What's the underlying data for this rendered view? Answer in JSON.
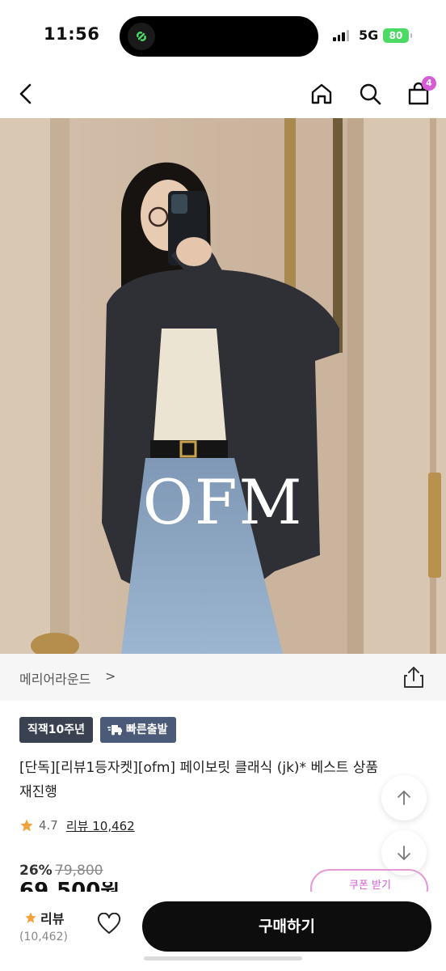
{
  "status": {
    "time": "11:56",
    "network": "5G",
    "battery": "80"
  },
  "nav": {
    "cart_count": "4"
  },
  "hero": {
    "overlay_text": "OFM"
  },
  "store": {
    "name": "메리어라운드",
    "chevron": ">"
  },
  "badges": {
    "tenure": "직잭10주년",
    "fast_shipping": "빠른출발"
  },
  "product": {
    "title": "[단독][리뷰1등자켓][ofm] 페이보릿 클래식 (jk)* 베스트 상품 재진행",
    "rating": "4.7",
    "reviews": "리뷰 10,462",
    "discount": "26%",
    "original_price": "79,800",
    "price": "69,500원"
  },
  "coupon": {
    "label": "쿠폰 받기"
  },
  "bottom": {
    "review_label": "리뷰",
    "review_count": "(10,462)",
    "buy_label": "구매하기"
  },
  "colors": {
    "accent": "#d65cd6",
    "buy": "#0d0d0d",
    "badge_dark": "#3a4150",
    "badge_blue": "#4a5a78",
    "star": "#f2a23a"
  }
}
